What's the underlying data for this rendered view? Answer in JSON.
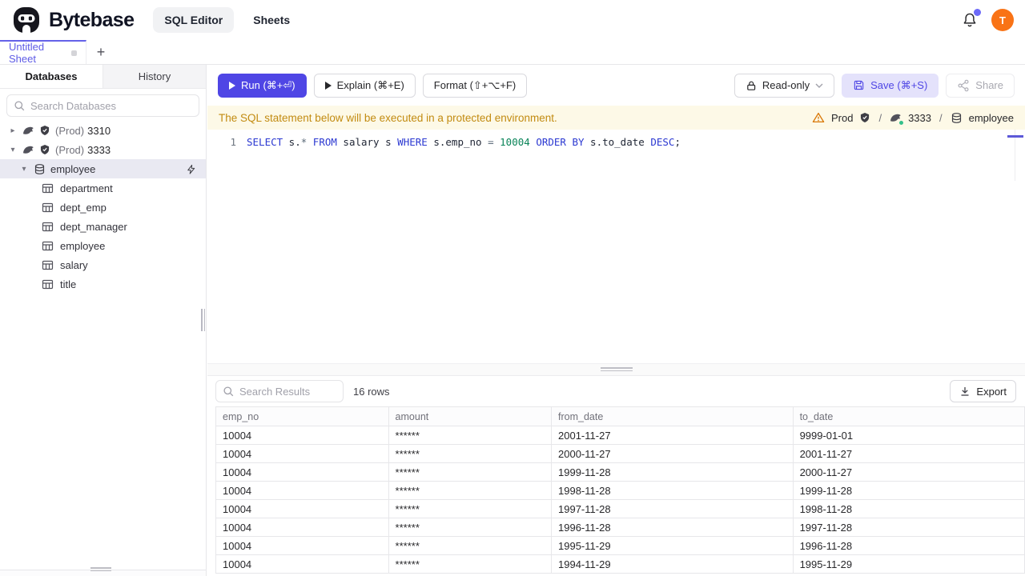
{
  "header": {
    "brand": "Bytebase",
    "nav": [
      {
        "label": "SQL Editor",
        "active": true
      },
      {
        "label": "Sheets",
        "active": false
      }
    ],
    "notification_badge": true,
    "avatar_initial": "T"
  },
  "sheet_tabs": {
    "active_tab": "Untitled Sheet",
    "new_tab": "+"
  },
  "sidebar": {
    "tabs": [
      {
        "label": "Databases",
        "active": true
      },
      {
        "label": "History",
        "active": false
      }
    ],
    "search_placeholder": "Search Databases",
    "instances": [
      {
        "env": "(Prod)",
        "name": "3310",
        "expanded": false
      },
      {
        "env": "(Prod)",
        "name": "3333",
        "expanded": true
      }
    ],
    "database": {
      "label": "employee",
      "selected": true
    },
    "tables": [
      "department",
      "dept_emp",
      "dept_manager",
      "employee",
      "salary",
      "title"
    ]
  },
  "toolbar": {
    "run": "Run (⌘+⏎)",
    "explain": "Explain (⌘+E)",
    "format": "Format (⇧+⌥+F)",
    "readonly": "Read-only",
    "save": "Save (⌘+S)",
    "share": "Share"
  },
  "banner": {
    "message": "The SQL statement below will be executed in a protected environment.",
    "environment": "Prod",
    "instance": "3333",
    "database": "employee",
    "separator": "/"
  },
  "editor": {
    "line_number": "1",
    "sql": "SELECT s.* FROM salary s WHERE s.emp_no = 10004 ORDER BY s.to_date DESC;",
    "tokens": [
      {
        "text": "SELECT",
        "type": "keyword"
      },
      {
        "text": " s.",
        "type": "plain"
      },
      {
        "text": "*",
        "type": "operator"
      },
      {
        "text": " ",
        "type": "plain"
      },
      {
        "text": "FROM",
        "type": "keyword"
      },
      {
        "text": " salary s ",
        "type": "plain"
      },
      {
        "text": "WHERE",
        "type": "keyword"
      },
      {
        "text": " s.emp_no ",
        "type": "plain"
      },
      {
        "text": "=",
        "type": "operator"
      },
      {
        "text": " ",
        "type": "plain"
      },
      {
        "text": "10004",
        "type": "number"
      },
      {
        "text": " ",
        "type": "plain"
      },
      {
        "text": "ORDER BY",
        "type": "keyword"
      },
      {
        "text": " s.to_date ",
        "type": "plain"
      },
      {
        "text": "DESC",
        "type": "keyword"
      },
      {
        "text": ";",
        "type": "plain"
      }
    ]
  },
  "results": {
    "search_placeholder": "Search Results",
    "row_count": "16 rows",
    "export": "Export",
    "table": {
      "columns": [
        "emp_no",
        "amount",
        "from_date",
        "to_date"
      ],
      "rows": [
        [
          "10004",
          "******",
          "2001-11-27",
          "9999-01-01"
        ],
        [
          "10004",
          "******",
          "2000-11-27",
          "2001-11-27"
        ],
        [
          "10004",
          "******",
          "1999-11-28",
          "2000-11-27"
        ],
        [
          "10004",
          "******",
          "1998-11-28",
          "1999-11-28"
        ],
        [
          "10004",
          "******",
          "1997-11-28",
          "1998-11-28"
        ],
        [
          "10004",
          "******",
          "1996-11-28",
          "1997-11-28"
        ],
        [
          "10004",
          "******",
          "1995-11-29",
          "1996-11-28"
        ],
        [
          "10004",
          "******",
          "1994-11-29",
          "1995-11-29"
        ]
      ]
    }
  },
  "colors": {
    "accent": "#4f46e5",
    "avatar": "#f97316",
    "warning_bg": "#fdf9e7",
    "warning_text": "#c28b11",
    "sql_keyword": "#2b38d1",
    "sql_number": "#0a8458",
    "selected_row_bg": "#e9e9f2",
    "status_green": "#34c08b"
  }
}
